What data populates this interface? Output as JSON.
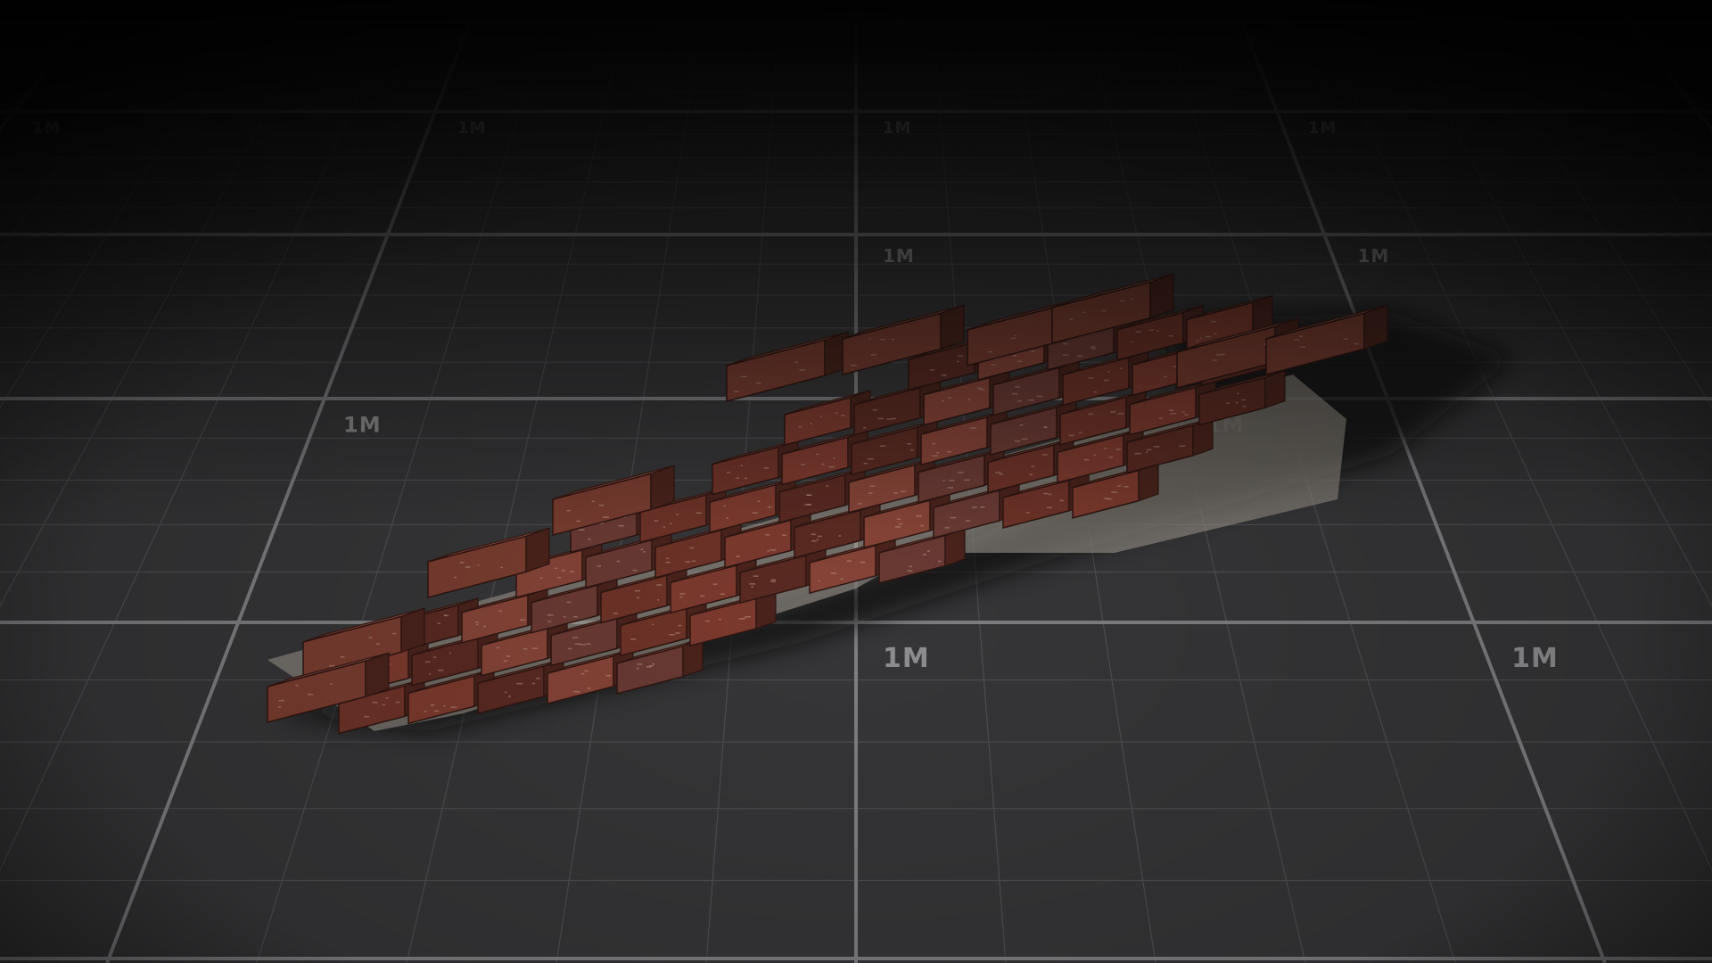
{
  "viewport": {
    "background": "#1a1a1b",
    "floor_color": "#3a3a3c",
    "major_grid_color": "#7f7f82",
    "minor_grid_color": "#4f4f52",
    "label_color": "#8e8e90"
  },
  "grid": {
    "cell_size_label": "1M",
    "labels": [
      "1M",
      "1M",
      "1M",
      "1M",
      "1M",
      "1M",
      "1M",
      "1M",
      "1M",
      "1M",
      "1M",
      "1M",
      "1M",
      "1M",
      "1M",
      "1M"
    ]
  },
  "model": {
    "subject": "broken-brick-wall",
    "brick_color": "#7a3d30",
    "mortar_color": "#a8a096"
  }
}
